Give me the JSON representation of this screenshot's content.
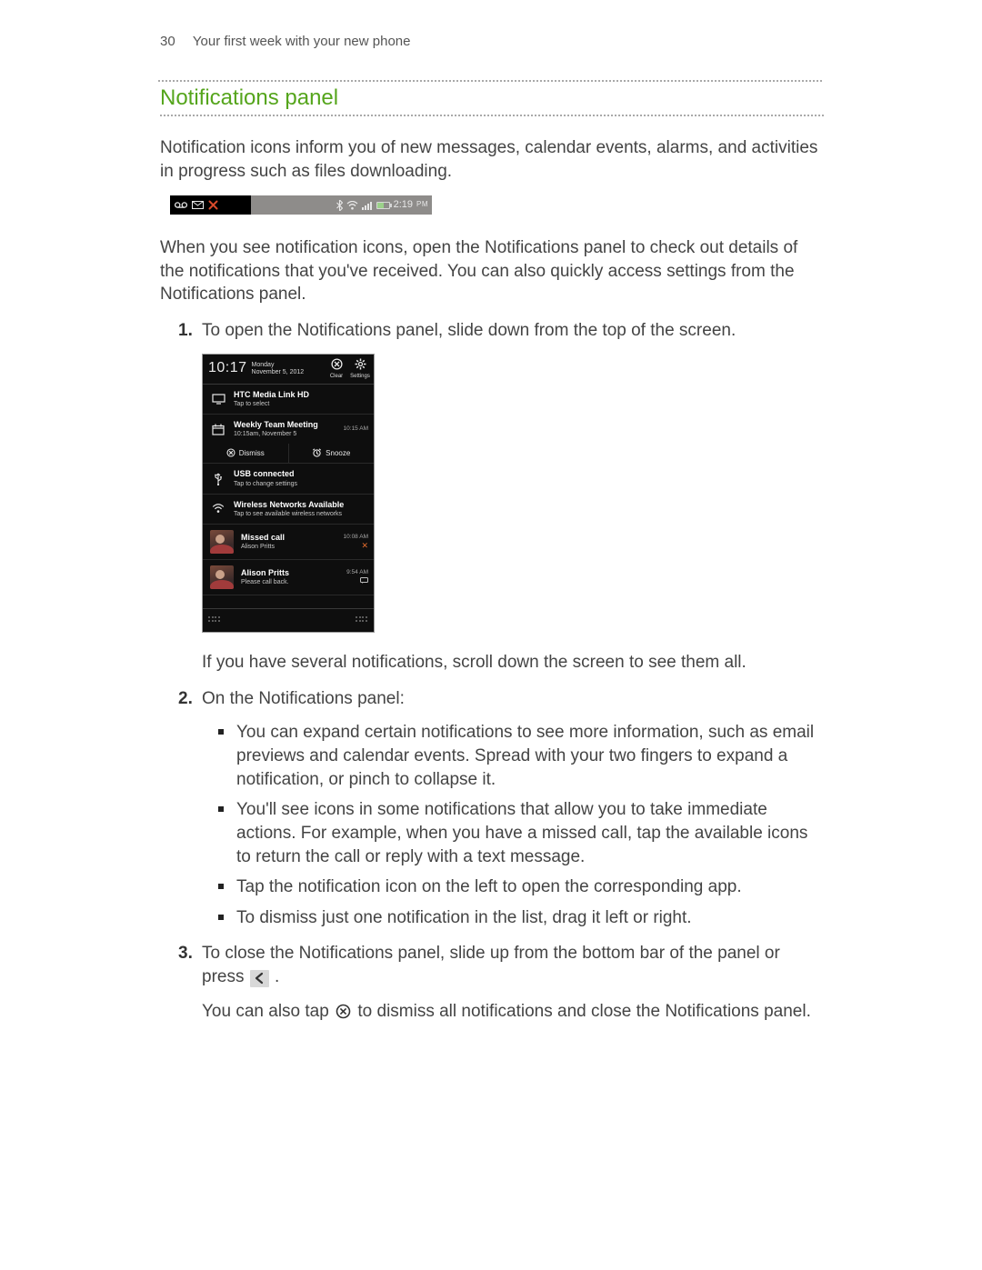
{
  "header": {
    "page_number": "30",
    "breadcrumb": "Your first week with your new phone"
  },
  "section": {
    "title": "Notifications panel"
  },
  "para": {
    "intro": "Notification icons inform you of new messages, calendar events, alarms, and activities in progress such as files downloading.",
    "after_statusbar": "When you see notification icons, open the Notifications panel to check out details of the notifications that you've received. You can also quickly access settings from the Notifications panel.",
    "scroll_hint": "If you have several notifications, scroll down the screen to see them all."
  },
  "statusbar": {
    "time": "2:19",
    "pm": "PM"
  },
  "steps": {
    "s1": "To open the Notifications panel, slide down from the top of the screen.",
    "s2": "On the Notifications panel:",
    "s2b1": "You can expand certain notifications to see more information, such as email previews and calendar events. Spread with your two fingers to expand a notification, or pinch to collapse it.",
    "s2b2": "You'll see icons in some notifications that allow you to take immediate actions. For example, when you have a missed call, tap the available icons to return the call or reply with a text message.",
    "s2b3": "Tap the notification icon on the left to open the corresponding app.",
    "s2b4": "To dismiss just one notification in the list, drag it left or right.",
    "s3a": "To close the Notifications panel, slide up from the bottom bar of the panel or press ",
    "s3b": " .",
    "s3c": "You can also tap ",
    "s3d": " to dismiss all notifications and close the Notifications panel."
  },
  "phone": {
    "clock": "10:17",
    "day": "Monday",
    "date": "November 5, 2012",
    "clear": "Clear",
    "settings": "Settings",
    "r1": {
      "t": "HTC Media Link HD",
      "s": "Tap to select"
    },
    "r2": {
      "t": "Weekly Team Meeting",
      "s": "10:15am, November 5",
      "m": "10:15 AM"
    },
    "act": {
      "dismiss": "Dismiss",
      "snooze": "Snooze"
    },
    "r3": {
      "t": "USB connected",
      "s": "Tap to change settings"
    },
    "r4": {
      "t": "Wireless Networks Available",
      "s": "Tap to see available wireless networks"
    },
    "r5": {
      "t": "Missed call",
      "s": "Alison Pritts",
      "m": "10:08 AM"
    },
    "r6": {
      "t": "Alison Pritts",
      "s": "Please call back.",
      "m": "9:54 AM"
    }
  }
}
